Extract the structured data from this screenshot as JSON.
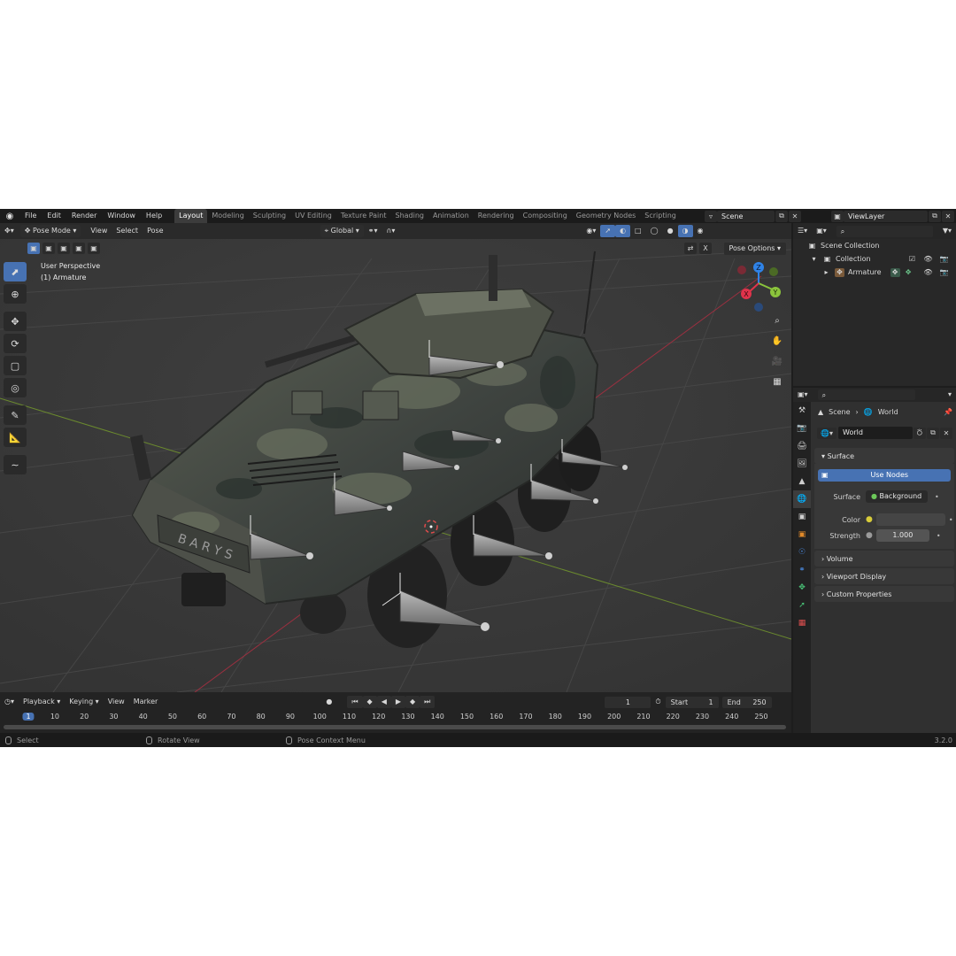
{
  "topbar": {
    "menus": [
      "File",
      "Edit",
      "Render",
      "Window",
      "Help"
    ],
    "workspaces": [
      "Layout",
      "Modeling",
      "Sculpting",
      "UV Editing",
      "Texture Paint",
      "Shading",
      "Animation",
      "Rendering",
      "Compositing",
      "Geometry Nodes",
      "Scripting"
    ],
    "active_workspace": "Layout",
    "scene_name": "Scene",
    "view_layer": "ViewLayer"
  },
  "viewport": {
    "mode": "Pose Mode",
    "menus": [
      "View",
      "Select",
      "Pose"
    ],
    "transform_orientation": "Global",
    "perspective_label": "User Perspective",
    "active_object_label": "(1) Armature",
    "pose_options": "Pose Options",
    "license_plate": "B A R Y S",
    "gizmo_axes": {
      "x": "X",
      "y": "Y",
      "z": "Z"
    },
    "colors": {
      "x_axis": "#e0334b",
      "y_axis": "#8bc43c",
      "z_axis": "#2f83e8",
      "active": "#4772b3"
    }
  },
  "timeline": {
    "menus": [
      "Playback",
      "Keying",
      "View",
      "Marker"
    ],
    "current_frame": "1",
    "start_label": "Start",
    "start_value": "1",
    "end_label": "End",
    "end_value": "250",
    "ticks": [
      "1",
      "10",
      "20",
      "30",
      "40",
      "50",
      "60",
      "70",
      "80",
      "90",
      "100",
      "110",
      "120",
      "130",
      "140",
      "150",
      "160",
      "170",
      "180",
      "190",
      "200",
      "210",
      "220",
      "230",
      "240",
      "250"
    ]
  },
  "statusbar": {
    "select": "Select",
    "rotate": "Rotate View",
    "context": "Pose Context Menu",
    "version": "3.2.0"
  },
  "outliner": {
    "scene_collection": "Scene Collection",
    "collection": "Collection",
    "armature": "Armature"
  },
  "properties": {
    "breadcrumb_scene": "Scene",
    "breadcrumb_world": "World",
    "world_name": "World",
    "surface_panel": "Surface",
    "use_nodes": "Use Nodes",
    "surface_label": "Surface",
    "surface_value": "Background",
    "color_label": "Color",
    "strength_label": "Strength",
    "strength_value": "1.000",
    "volume_panel": "Volume",
    "viewport_display_panel": "Viewport Display",
    "custom_properties_panel": "Custom Properties"
  }
}
